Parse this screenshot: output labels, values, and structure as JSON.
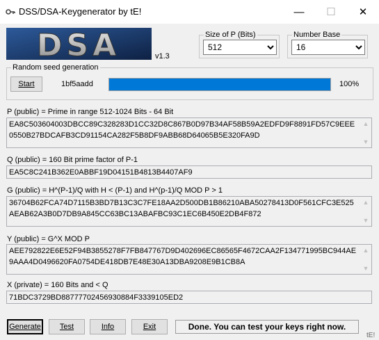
{
  "window": {
    "title": "DSS/DSA-Keygenerator by tE!",
    "minimize_glyph": "—",
    "maximize_glyph": "☐",
    "close_glyph": "✕",
    "icon": "key-icon"
  },
  "logo": {
    "text": "DSA",
    "version": "v1.3"
  },
  "size_of_p": {
    "legend": "Size of P (Bits)",
    "selected": "512"
  },
  "number_base": {
    "legend": "Number Base",
    "selected": "16"
  },
  "random_seed": {
    "legend": "Random seed generation",
    "start_label": "Start",
    "seed_value": "1bf5aadd",
    "progress": 1.0,
    "progress_text": "100%"
  },
  "fields": {
    "p": {
      "label": "P (public) = Prime in range 512-1024 Bits - 64 Bit",
      "value": "EA8C503604003DBCC89C328283D1CC32D8C867B0D97B34AF58B59A2EDFD9F8891FD57C9EEE0550B27BDCAFB3CD91154CA282F5B8DF9ABB68D64065B5E320FA9D"
    },
    "q": {
      "label": "Q (public) = 160 Bit prime factor of P-1",
      "value": "EA5C8C241B362E0ABBF19D04151B4813B4407AF9"
    },
    "g": {
      "label": "G (public) = H^(P-1)/Q with H < (P-1) and H^(p-1)/Q MOD P > 1",
      "value": "36704B62FCA74D7115B3BD7B13C3C7FE18AA2D500DB1B86210ABA50278413D0F561CFC3E525AEAB62A3B0D7DB9A845CC63BC13ABAFBC93C1EC6B450E2DB4F872"
    },
    "y": {
      "label": "Y (public) = G^X MOD P",
      "value": "AEE792822E6E52F94B3855278F7FB847767D9D402696EC86565F4672CAA2F134771995BC944AE9AAA4D0496620FA0754DE418DB7E48E30A13DBA9208E9B1CB8A"
    },
    "x": {
      "label": "X (private) = 160 Bits and < Q",
      "value": "71BDC3729BD88777702456930884F3339105ED2"
    }
  },
  "buttons": {
    "generate": "Generate",
    "test": "Test",
    "info": "Info",
    "exit": "Exit"
  },
  "status_text": "Done. You can test your keys right now.",
  "credit": "tE!",
  "colors": {
    "progress": "#0078d7",
    "logo_bg": "#1f3f73"
  }
}
